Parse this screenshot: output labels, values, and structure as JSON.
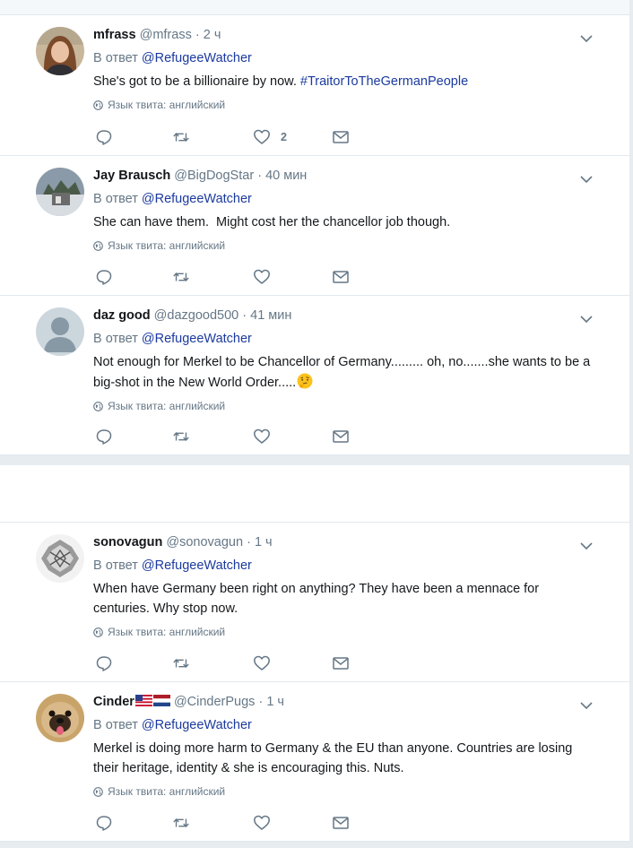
{
  "lang_label": "Язык твита: английский",
  "reply_prefix": "В ответ",
  "tweets": [
    {
      "name": "mfrass",
      "handle": "@mfrass",
      "time": "2 ч",
      "reply_to": "@RefugeeWatcher",
      "text": "She's got to be a billionaire by now. ",
      "hashtag": "#TraitorToTheGermanPeople",
      "likes": "2"
    },
    {
      "name": "Jay Brausch",
      "handle": "@BigDogStar",
      "time": "40 мин",
      "reply_to": "@RefugeeWatcher",
      "text": "She can have them.  Might cost her the chancellor job though."
    },
    {
      "name": "daz good",
      "handle": "@dazgood500",
      "time": "41 мин",
      "reply_to": "@RefugeeWatcher",
      "text_line1": "Not enough for Merkel to be Chancellor of Germany......... oh, no.......she wants to be a",
      "text_line2": "big-shot in the New World Order.....",
      "emoji": "thinking-face"
    },
    {
      "name": "sonovagun",
      "handle": "@sonovagun",
      "time": "1 ч",
      "reply_to": "@RefugeeWatcher",
      "text_line1": "When have Germany been right on anything? They have been a mennace for",
      "text_line2": "centuries. Why stop now."
    },
    {
      "name": "Cinder",
      "flags": [
        "us-flag",
        "nl-flag"
      ],
      "handle": "@CinderPugs",
      "time": "1 ч",
      "reply_to": "@RefugeeWatcher",
      "text_line1": "Merkel is doing more harm to Germany & the EU than anyone. Countries are losing",
      "text_line2": "their heritage, identity & she is encouraging this. Nuts."
    }
  ],
  "colors": {
    "link": "#1b3a9e",
    "muted": "#657786",
    "separator": "#e6ecf0"
  }
}
